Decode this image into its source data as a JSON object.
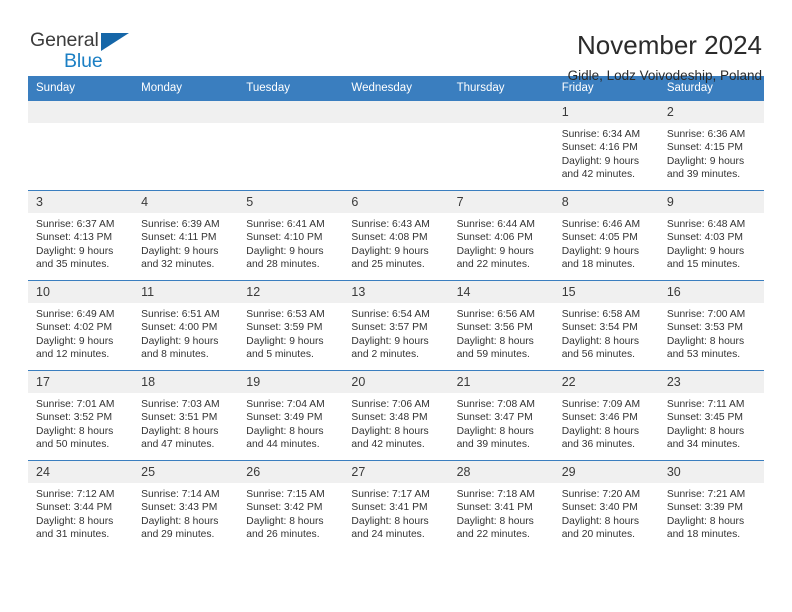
{
  "brand": {
    "name_part1": "General",
    "name_part2": "Blue",
    "triangle_icon": "triangle-icon",
    "accent_color": "#1b7fc4"
  },
  "header": {
    "title": "November 2024",
    "subtitle": "Gidle, Lodz Voivodeship, Poland"
  },
  "theme": {
    "header_blue": "#3a7ebf",
    "daynum_gray": "#f0f0f0"
  },
  "weekdays": [
    "Sunday",
    "Monday",
    "Tuesday",
    "Wednesday",
    "Thursday",
    "Friday",
    "Saturday"
  ],
  "weeks": [
    [
      {
        "day": "",
        "lines": []
      },
      {
        "day": "",
        "lines": []
      },
      {
        "day": "",
        "lines": []
      },
      {
        "day": "",
        "lines": []
      },
      {
        "day": "",
        "lines": []
      },
      {
        "day": "1",
        "lines": [
          "Sunrise: 6:34 AM",
          "Sunset: 4:16 PM",
          "Daylight: 9 hours",
          "and 42 minutes."
        ]
      },
      {
        "day": "2",
        "lines": [
          "Sunrise: 6:36 AM",
          "Sunset: 4:15 PM",
          "Daylight: 9 hours",
          "and 39 minutes."
        ]
      }
    ],
    [
      {
        "day": "3",
        "lines": [
          "Sunrise: 6:37 AM",
          "Sunset: 4:13 PM",
          "Daylight: 9 hours",
          "and 35 minutes."
        ]
      },
      {
        "day": "4",
        "lines": [
          "Sunrise: 6:39 AM",
          "Sunset: 4:11 PM",
          "Daylight: 9 hours",
          "and 32 minutes."
        ]
      },
      {
        "day": "5",
        "lines": [
          "Sunrise: 6:41 AM",
          "Sunset: 4:10 PM",
          "Daylight: 9 hours",
          "and 28 minutes."
        ]
      },
      {
        "day": "6",
        "lines": [
          "Sunrise: 6:43 AM",
          "Sunset: 4:08 PM",
          "Daylight: 9 hours",
          "and 25 minutes."
        ]
      },
      {
        "day": "7",
        "lines": [
          "Sunrise: 6:44 AM",
          "Sunset: 4:06 PM",
          "Daylight: 9 hours",
          "and 22 minutes."
        ]
      },
      {
        "day": "8",
        "lines": [
          "Sunrise: 6:46 AM",
          "Sunset: 4:05 PM",
          "Daylight: 9 hours",
          "and 18 minutes."
        ]
      },
      {
        "day": "9",
        "lines": [
          "Sunrise: 6:48 AM",
          "Sunset: 4:03 PM",
          "Daylight: 9 hours",
          "and 15 minutes."
        ]
      }
    ],
    [
      {
        "day": "10",
        "lines": [
          "Sunrise: 6:49 AM",
          "Sunset: 4:02 PM",
          "Daylight: 9 hours",
          "and 12 minutes."
        ]
      },
      {
        "day": "11",
        "lines": [
          "Sunrise: 6:51 AM",
          "Sunset: 4:00 PM",
          "Daylight: 9 hours",
          "and 8 minutes."
        ]
      },
      {
        "day": "12",
        "lines": [
          "Sunrise: 6:53 AM",
          "Sunset: 3:59 PM",
          "Daylight: 9 hours",
          "and 5 minutes."
        ]
      },
      {
        "day": "13",
        "lines": [
          "Sunrise: 6:54 AM",
          "Sunset: 3:57 PM",
          "Daylight: 9 hours",
          "and 2 minutes."
        ]
      },
      {
        "day": "14",
        "lines": [
          "Sunrise: 6:56 AM",
          "Sunset: 3:56 PM",
          "Daylight: 8 hours",
          "and 59 minutes."
        ]
      },
      {
        "day": "15",
        "lines": [
          "Sunrise: 6:58 AM",
          "Sunset: 3:54 PM",
          "Daylight: 8 hours",
          "and 56 minutes."
        ]
      },
      {
        "day": "16",
        "lines": [
          "Sunrise: 7:00 AM",
          "Sunset: 3:53 PM",
          "Daylight: 8 hours",
          "and 53 minutes."
        ]
      }
    ],
    [
      {
        "day": "17",
        "lines": [
          "Sunrise: 7:01 AM",
          "Sunset: 3:52 PM",
          "Daylight: 8 hours",
          "and 50 minutes."
        ]
      },
      {
        "day": "18",
        "lines": [
          "Sunrise: 7:03 AM",
          "Sunset: 3:51 PM",
          "Daylight: 8 hours",
          "and 47 minutes."
        ]
      },
      {
        "day": "19",
        "lines": [
          "Sunrise: 7:04 AM",
          "Sunset: 3:49 PM",
          "Daylight: 8 hours",
          "and 44 minutes."
        ]
      },
      {
        "day": "20",
        "lines": [
          "Sunrise: 7:06 AM",
          "Sunset: 3:48 PM",
          "Daylight: 8 hours",
          "and 42 minutes."
        ]
      },
      {
        "day": "21",
        "lines": [
          "Sunrise: 7:08 AM",
          "Sunset: 3:47 PM",
          "Daylight: 8 hours",
          "and 39 minutes."
        ]
      },
      {
        "day": "22",
        "lines": [
          "Sunrise: 7:09 AM",
          "Sunset: 3:46 PM",
          "Daylight: 8 hours",
          "and 36 minutes."
        ]
      },
      {
        "day": "23",
        "lines": [
          "Sunrise: 7:11 AM",
          "Sunset: 3:45 PM",
          "Daylight: 8 hours",
          "and 34 minutes."
        ]
      }
    ],
    [
      {
        "day": "24",
        "lines": [
          "Sunrise: 7:12 AM",
          "Sunset: 3:44 PM",
          "Daylight: 8 hours",
          "and 31 minutes."
        ]
      },
      {
        "day": "25",
        "lines": [
          "Sunrise: 7:14 AM",
          "Sunset: 3:43 PM",
          "Daylight: 8 hours",
          "and 29 minutes."
        ]
      },
      {
        "day": "26",
        "lines": [
          "Sunrise: 7:15 AM",
          "Sunset: 3:42 PM",
          "Daylight: 8 hours",
          "and 26 minutes."
        ]
      },
      {
        "day": "27",
        "lines": [
          "Sunrise: 7:17 AM",
          "Sunset: 3:41 PM",
          "Daylight: 8 hours",
          "and 24 minutes."
        ]
      },
      {
        "day": "28",
        "lines": [
          "Sunrise: 7:18 AM",
          "Sunset: 3:41 PM",
          "Daylight: 8 hours",
          "and 22 minutes."
        ]
      },
      {
        "day": "29",
        "lines": [
          "Sunrise: 7:20 AM",
          "Sunset: 3:40 PM",
          "Daylight: 8 hours",
          "and 20 minutes."
        ]
      },
      {
        "day": "30",
        "lines": [
          "Sunrise: 7:21 AM",
          "Sunset: 3:39 PM",
          "Daylight: 8 hours",
          "and 18 minutes."
        ]
      }
    ]
  ]
}
